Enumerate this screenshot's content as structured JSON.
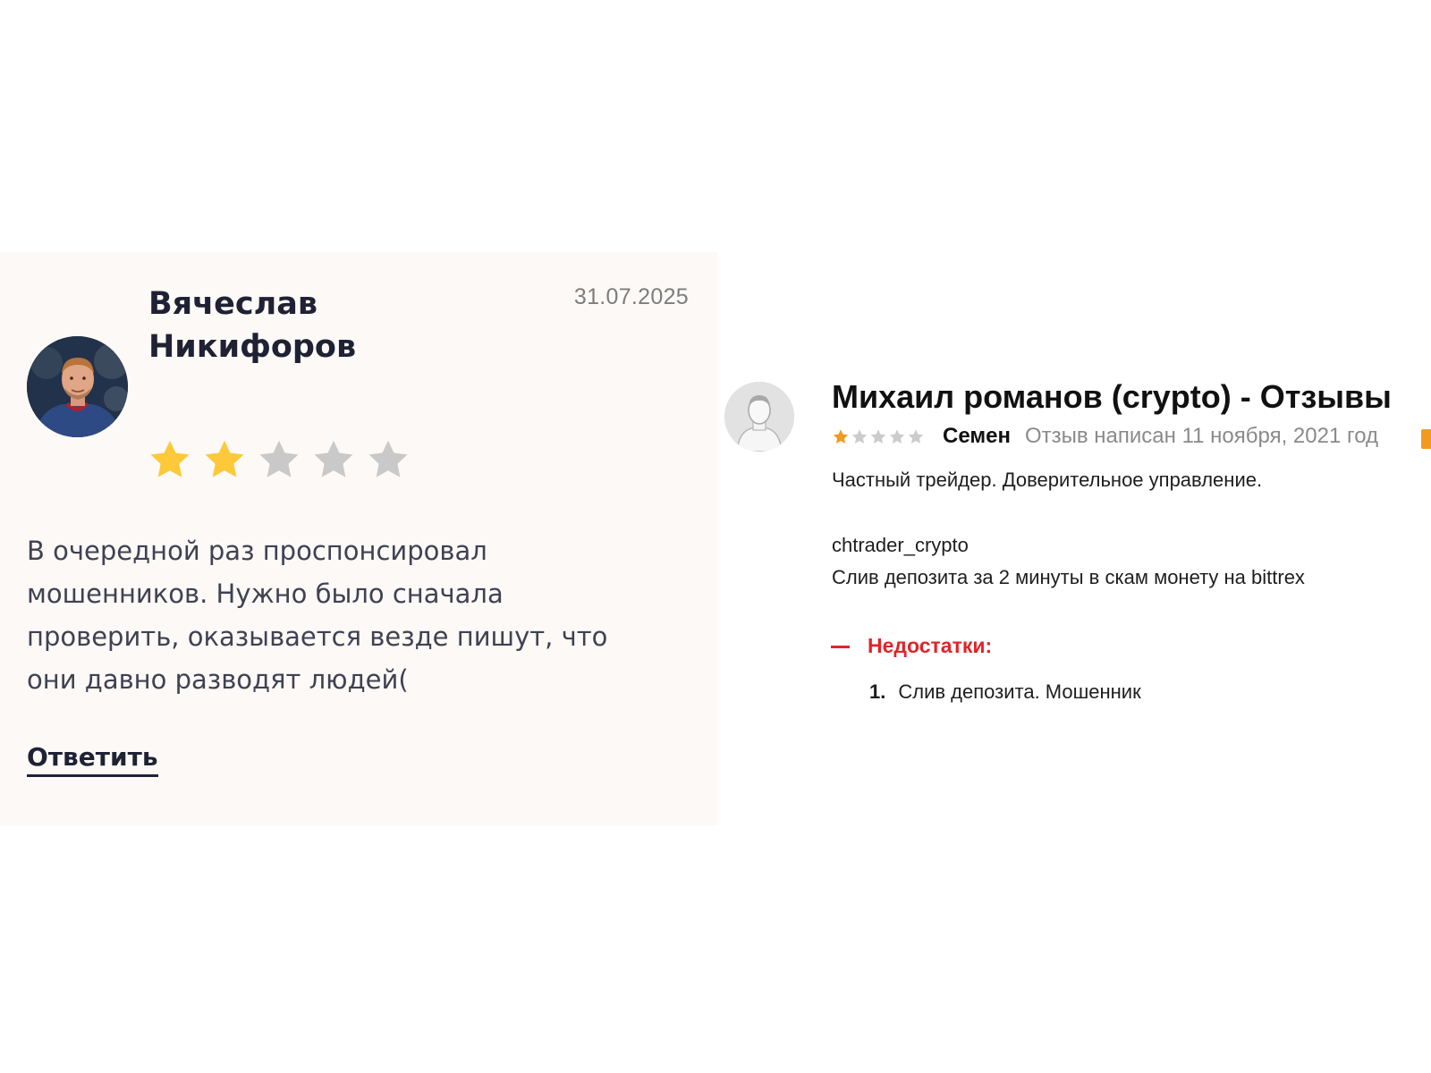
{
  "left_review": {
    "author_first": "Вячеслав",
    "author_last": "Никифоров",
    "date": "31.07.2025",
    "rating": 2,
    "max_rating": 5,
    "text": "В очередной раз проспонсировал мошенников. Нужно было сначала проверить, оказывается везде пишут, что они давно разводят людей(",
    "reply_label": "Ответить",
    "colors": {
      "star_filled": "#fdc93a",
      "star_empty": "#c9c9c9",
      "card_bg": "#fcf9f7"
    }
  },
  "right_review": {
    "title": "Михаил романов (crypto) - Отзывы",
    "rating": 1,
    "max_rating": 5,
    "author": "Семен",
    "date_text": "Отзыв написан 11 ноября, 2021 год",
    "body_line1": "Частный трейдер. Доверительное управление.",
    "body_line2": "chtrader_crypto",
    "body_line3": "Слив депозита за 2 минуты в скам монету на bittrex",
    "cons_label": "Недостатки:",
    "cons_items": [
      {
        "num": "1.",
        "text": "Слив депозита. Мошенник"
      }
    ],
    "colors": {
      "star_filled": "#f29a1f",
      "star_empty": "#cccccc",
      "cons": "#e0242a"
    }
  }
}
